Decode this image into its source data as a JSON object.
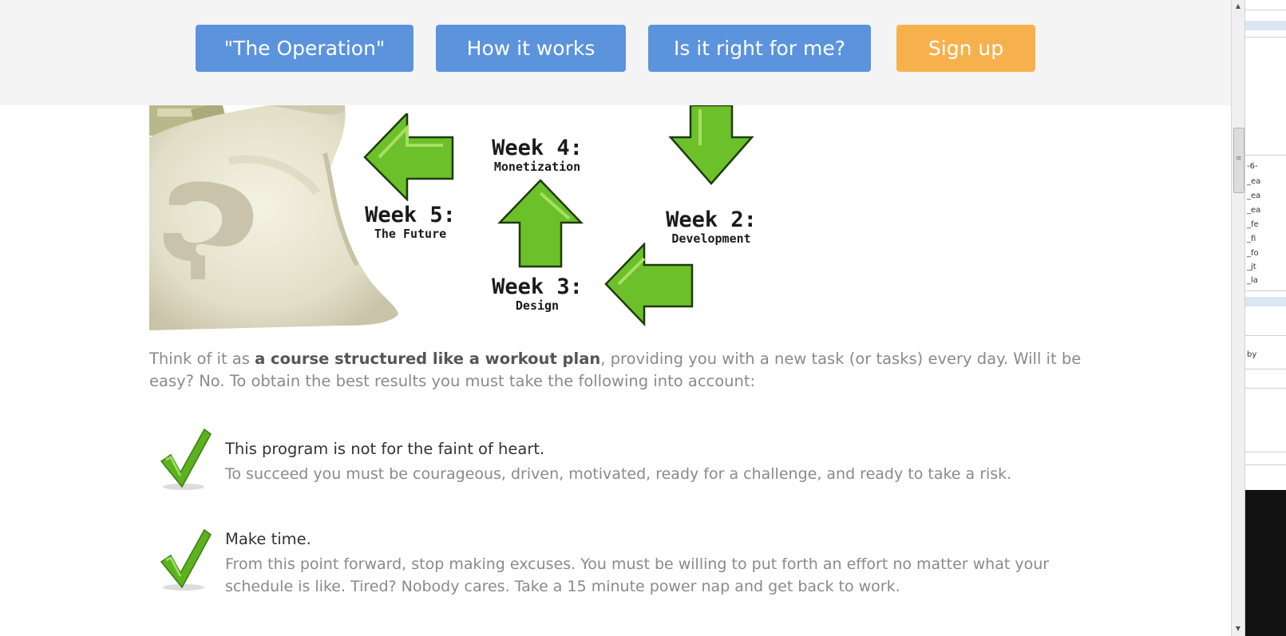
{
  "nav": {
    "buttons": [
      {
        "label": "\"The Operation\""
      },
      {
        "label": "How it works"
      },
      {
        "label": "Is it right for me?"
      },
      {
        "label": "Sign up"
      }
    ],
    "accent_blue": "#5b93dd",
    "accent_orange": "#f7b14c"
  },
  "hero": {
    "week4": {
      "title": "Week 4:",
      "subtitle": "Monetization"
    },
    "week5": {
      "title": "Week 5:",
      "subtitle": "The Future"
    },
    "week2": {
      "title": "Week 2:",
      "subtitle": "Development"
    },
    "week3": {
      "title": "Week 3:",
      "subtitle": "Design"
    },
    "arrow_color": "#6cc02a"
  },
  "intro": {
    "before": "Think of it as ",
    "bold": "a course structured like a workout plan",
    "after": ", providing you with a new task (or tasks) every day. Will it be easy? No. To obtain the best results you must take the following into account:"
  },
  "items": [
    {
      "title": "This program is not for the faint of heart.",
      "desc": "To succeed you must be courageous, driven, motivated, ready for a challenge, and ready to take a risk.",
      "icon": "checkmark-icon"
    },
    {
      "title": "Make time.",
      "desc": "From this point forward, stop making excuses. You must be willing to put forth an effort no matter what your schedule is like. Tired? Nobody cares. Take a 15 minute power nap and get back to work.",
      "icon": "checkmark-icon"
    }
  ],
  "side_panel": {
    "lines": [
      "-6-",
      "_ea",
      "_ea",
      "_ea",
      "_fe",
      "_fi",
      "_fo",
      "_jt",
      "_la"
    ],
    "footer": "by"
  }
}
